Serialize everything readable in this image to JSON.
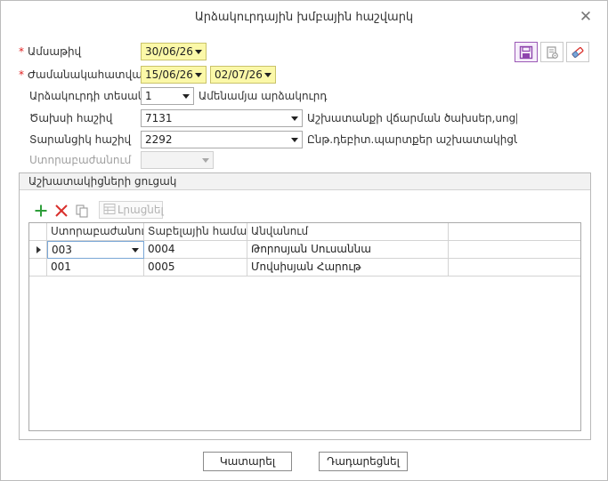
{
  "window": {
    "title": "Արձակուրդային խմբային հաշվարկ"
  },
  "form": {
    "date": {
      "label": "Ամսաթիվ",
      "value": "30/06/26"
    },
    "period": {
      "label": "Ժամանակահատված",
      "from": "15/06/26",
      "to": "02/07/26"
    },
    "vacation_type": {
      "label": "Արձակուրդի տեսակ",
      "value": "1",
      "description": "Ամենամյա արձակուրդ"
    },
    "expense_account": {
      "label": "Ծախսի հաշիվ",
      "value": "7131",
      "description": "Աշխատանքի վճարման ծախսեր,սոցիալ.ա"
    },
    "liability_account": {
      "label": "Տարանցիկ հաշիվ",
      "value": "2292",
      "description": "Ընթ.դեբիտ.պարտքեր աշխատակիցների"
    },
    "division": {
      "label": "Ստորաբաժանում",
      "value": ""
    }
  },
  "toolbar": {
    "icons": [
      "save-icon",
      "settings-doc-icon",
      "eraser-icon"
    ],
    "accent": "#9b59b6"
  },
  "employees": {
    "group_title": "Աշխատակիցների ցուցակ",
    "add_icon": "plus-icon",
    "delete_icon": "x-icon",
    "copy_icon": "copy-icon",
    "fill_label": "Լրացնել",
    "columns": [
      "Ստորաբաժանում",
      "Տաբելային համար",
      "Անվանում"
    ],
    "rows": [
      {
        "division": "003",
        "tab_no": "0004",
        "name": "Թորոսյան Սուսաննա"
      },
      {
        "division": "001",
        "tab_no": "0005",
        "name": "Մովսիսյան Հարութ"
      }
    ]
  },
  "buttons": {
    "ok": "Կատարել",
    "cancel": "Դադարեցնել"
  },
  "colors": {
    "required": "#e02020",
    "highlight_field": "#fbf8a8",
    "add": "#2e9e3a",
    "delete": "#d9302c"
  }
}
